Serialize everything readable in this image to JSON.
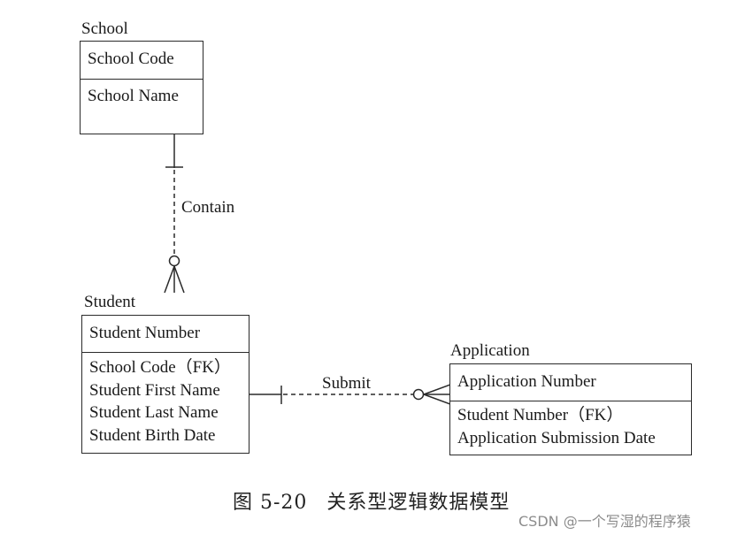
{
  "entities": {
    "school": {
      "name": "School",
      "primary_key": "School Code",
      "attributes": [
        "School Name"
      ]
    },
    "student": {
      "name": "Student",
      "primary_key": "Student Number",
      "attributes": [
        "School Code（FK）",
        "Student First Name",
        "Student Last Name",
        "Student Birth Date"
      ]
    },
    "application": {
      "name": "Application",
      "primary_key": "Application Number",
      "attributes": [
        "Student Number（FK）",
        "Application Submission Date"
      ]
    }
  },
  "relationships": [
    {
      "label": "Contain",
      "from": "School",
      "to": "Student",
      "from_cardinality": "one",
      "to_cardinality": "zero-or-many"
    },
    {
      "label": "Submit",
      "from": "Student",
      "to": "Application",
      "from_cardinality": "one",
      "to_cardinality": "zero-or-many"
    }
  ],
  "caption": {
    "figure_number": "图 5-20",
    "title": "关系型逻辑数据模型"
  },
  "watermark": "CSDN @一个写湿的程序猿"
}
